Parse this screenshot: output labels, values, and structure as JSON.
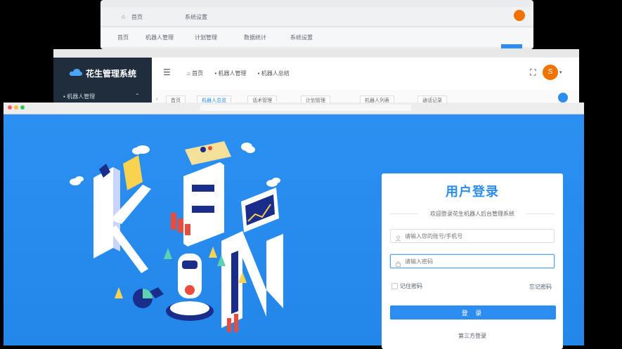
{
  "back_window": {
    "tabs": [
      "首页",
      "机器人管理",
      "计划管理",
      "数据统计",
      "系统设置"
    ],
    "breadcrumb": [
      "首页",
      "系统设置"
    ]
  },
  "middle_window": {
    "logo_text": "花生管理系统",
    "sidebar_first_item": "机器人管理",
    "breadcrumb": [
      "首页",
      "机器人管理",
      "机器人总结"
    ],
    "avatar_letter": "S",
    "tags": [
      "首页",
      "机器人总览",
      "话术管理",
      "计划管理",
      "机器人列表",
      "通话记录"
    ]
  },
  "login": {
    "title": "用户登录",
    "subtitle": "欢迎登录花生机器人后台管理系统",
    "username_placeholder": "请输入您的账号/手机号",
    "password_placeholder": "请输入密码",
    "remember_label": "记住密码",
    "forgot_label": "忘记密码",
    "login_button": "登 录",
    "third_party": "第三方登录"
  },
  "colors": {
    "accent": "#2d8cf0",
    "background": "#2a8ff0",
    "sidebar": "#1f2d3d",
    "avatar": "#f07300"
  }
}
